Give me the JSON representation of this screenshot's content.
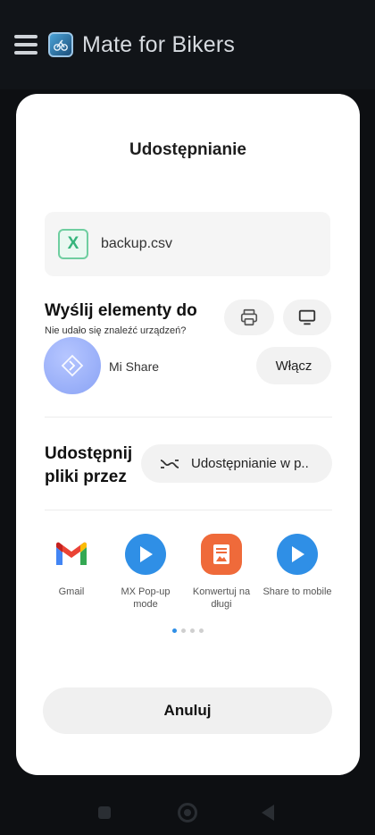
{
  "app_bar": {
    "title": "Mate for Bikers"
  },
  "sheet": {
    "title": "Udostępnianie",
    "file": {
      "name": "backup.csv",
      "icon_letter": "X"
    },
    "send": {
      "title": "Wyślij elementy do",
      "subtitle": "Nie udało się znaleźć urządzeń?",
      "mishare_label": "Mi Share",
      "enable_label": "Włącz"
    },
    "share": {
      "title": "Udostępnij pliki przez",
      "via_label": "Udostępnianie w p.."
    },
    "apps": [
      {
        "label": "Gmail",
        "icon": "gmail-icon"
      },
      {
        "label": "MX Pop-up mode",
        "icon": "play-icon"
      },
      {
        "label": "Konwertuj na długi",
        "icon": "image-doc-icon"
      },
      {
        "label": "Share to mobile",
        "icon": "play-icon"
      }
    ],
    "pager": {
      "active": 0,
      "count": 4
    },
    "cancel_label": "Anuluj"
  },
  "colors": {
    "accent_blue": "#2f8fe6",
    "file_green": "#36b47b",
    "mishare_blue": "#8aa3f5",
    "convert_orange": "#ef6a3a"
  }
}
